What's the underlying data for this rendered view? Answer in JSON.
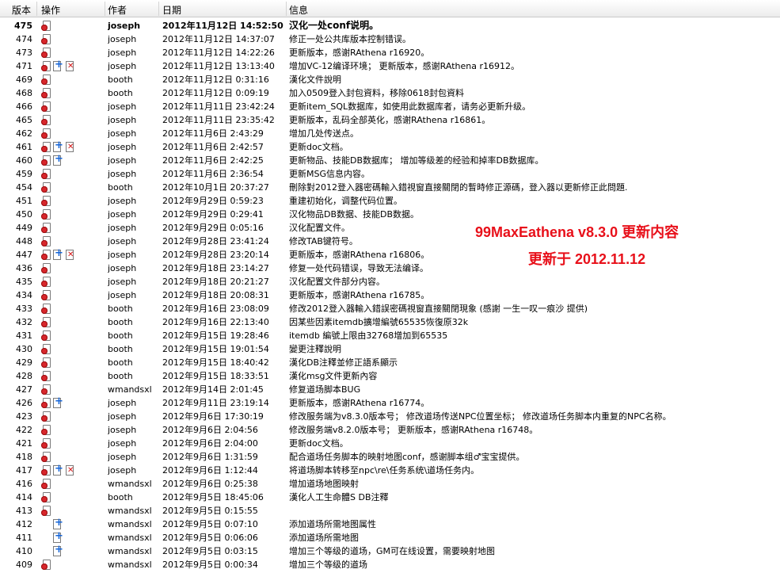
{
  "header": {
    "rev": "版本",
    "ops": "操作",
    "author": "作者",
    "date": "日期",
    "message": "信息"
  },
  "overlay": {
    "line1": "99MaxEathena v8.3.0 更新内容",
    "line2": "更新于 2012.11.12"
  },
  "rows": [
    {
      "rev": "475",
      "ops": [
        "file-doc-icon"
      ],
      "author": "joseph",
      "date": "2012年11月12日 14:52:50",
      "message": "汉化一处conf说明。"
    },
    {
      "rev": "474",
      "ops": [
        "file-doc-icon"
      ],
      "author": "joseph",
      "date": "2012年11月12日 14:37:07",
      "message": "修正一处公共库版本控制错误。"
    },
    {
      "rev": "473",
      "ops": [
        "file-doc-icon"
      ],
      "author": "joseph",
      "date": "2012年11月12日 14:22:26",
      "message": "更新版本，感谢RAthena r16920。"
    },
    {
      "rev": "471",
      "ops": [
        "file-doc-icon",
        "file-add-icon",
        "file-delete-icon"
      ],
      "author": "joseph",
      "date": "2012年11月12日 13:13:40",
      "message": "增加VC-12编译环境； 更新版本，感谢RAthena r16912。"
    },
    {
      "rev": "469",
      "ops": [
        "file-doc-icon"
      ],
      "author": "booth",
      "date": "2012年11月12日 0:31:16",
      "message": "漢化文件說明"
    },
    {
      "rev": "468",
      "ops": [
        "file-doc-icon"
      ],
      "author": "booth",
      "date": "2012年11月12日 0:09:19",
      "message": "加入0509登入封包資料，移除0618封包資料"
    },
    {
      "rev": "466",
      "ops": [
        "file-doc-icon"
      ],
      "author": "joseph",
      "date": "2012年11月11日 23:42:24",
      "message": "更新item_SQL数据库，如使用此数据库者，请务必更新升级。"
    },
    {
      "rev": "465",
      "ops": [
        "file-doc-icon"
      ],
      "author": "joseph",
      "date": "2012年11月11日 23:35:42",
      "message": "更新版本，乱码全部英化，感谢RAthena r16861。"
    },
    {
      "rev": "462",
      "ops": [
        "file-doc-icon"
      ],
      "author": "joseph",
      "date": "2012年11月6日 2:43:29",
      "message": "增加几处传送点。"
    },
    {
      "rev": "461",
      "ops": [
        "file-doc-icon",
        "file-add-icon",
        "file-delete-icon"
      ],
      "author": "joseph",
      "date": "2012年11月6日 2:42:57",
      "message": "更新doc文档。"
    },
    {
      "rev": "460",
      "ops": [
        "file-doc-icon",
        "file-add-icon"
      ],
      "author": "joseph",
      "date": "2012年11月6日 2:42:25",
      "message": "更新物品、技能DB数据库； 增加等级差的经验和掉率DB数据库。"
    },
    {
      "rev": "459",
      "ops": [
        "file-doc-icon"
      ],
      "author": "joseph",
      "date": "2012年11月6日 2:36:54",
      "message": "更新MSG信息内容。"
    },
    {
      "rev": "454",
      "ops": [
        "file-doc-icon"
      ],
      "author": "booth",
      "date": "2012年10月1日 20:37:27",
      "message": "刪除對2012登入器密碼輸入錯視窗直接關閉的暫時修正源碼，登入器以更新修正此問題."
    },
    {
      "rev": "451",
      "ops": [
        "file-doc-icon"
      ],
      "author": "joseph",
      "date": "2012年9月29日 0:59:23",
      "message": "重建初始化，调整代码位置。"
    },
    {
      "rev": "450",
      "ops": [
        "file-doc-icon"
      ],
      "author": "joseph",
      "date": "2012年9月29日 0:29:41",
      "message": "汉化物品DB数据、技能DB数据。"
    },
    {
      "rev": "449",
      "ops": [
        "file-doc-icon"
      ],
      "author": "joseph",
      "date": "2012年9月29日 0:05:16",
      "message": "汉化配置文件。"
    },
    {
      "rev": "448",
      "ops": [
        "file-doc-icon"
      ],
      "author": "joseph",
      "date": "2012年9月28日 23:41:24",
      "message": "修改TAB键符号。"
    },
    {
      "rev": "447",
      "ops": [
        "file-doc-icon",
        "file-add-icon",
        "file-delete-icon"
      ],
      "author": "joseph",
      "date": "2012年9月28日 23:20:14",
      "message": "更新版本，感谢RAthena r16806。"
    },
    {
      "rev": "436",
      "ops": [
        "file-doc-icon"
      ],
      "author": "joseph",
      "date": "2012年9月18日 23:14:27",
      "message": "修复一处代码错误，导致无法编译。"
    },
    {
      "rev": "435",
      "ops": [
        "file-doc-icon"
      ],
      "author": "joseph",
      "date": "2012年9月18日 20:21:27",
      "message": "汉化配置文件部分内容。"
    },
    {
      "rev": "434",
      "ops": [
        "file-doc-icon"
      ],
      "author": "joseph",
      "date": "2012年9月18日 20:08:31",
      "message": "更新版本，感谢RAthena r16785。"
    },
    {
      "rev": "433",
      "ops": [
        "file-doc-icon"
      ],
      "author": "booth",
      "date": "2012年9月16日 23:08:09",
      "message": "修改2012登入器輸入錯誤密碼視窗直接關閉現象 (感謝 一生一叹一痕沙 提供)"
    },
    {
      "rev": "432",
      "ops": [
        "file-doc-icon"
      ],
      "author": "booth",
      "date": "2012年9月16日 22:13:40",
      "message": "因某些因素itemdb擴增編號65535恢復原32k"
    },
    {
      "rev": "431",
      "ops": [
        "file-doc-icon"
      ],
      "author": "booth",
      "date": "2012年9月15日 19:28:46",
      "message": "itemdb 編號上限由32768增加到65535"
    },
    {
      "rev": "430",
      "ops": [
        "file-doc-icon"
      ],
      "author": "booth",
      "date": "2012年9月15日 19:01:54",
      "message": "變更注釋說明"
    },
    {
      "rev": "429",
      "ops": [
        "file-doc-icon"
      ],
      "author": "booth",
      "date": "2012年9月15日 18:40:42",
      "message": "漢化DB注釋並修正語系顯示"
    },
    {
      "rev": "428",
      "ops": [
        "file-doc-icon"
      ],
      "author": "booth",
      "date": "2012年9月15日 18:33:51",
      "message": "漢化msg文件更新內容"
    },
    {
      "rev": "427",
      "ops": [
        "file-doc-icon"
      ],
      "author": "wmandsxl",
      "date": "2012年9月14日 2:01:45",
      "message": "修复道场脚本BUG"
    },
    {
      "rev": "426",
      "ops": [
        "file-doc-icon",
        "file-add-icon"
      ],
      "author": "joseph",
      "date": "2012年9月11日 23:19:14",
      "message": "更新版本，感谢RAthena r16774。"
    },
    {
      "rev": "423",
      "ops": [
        "file-doc-icon"
      ],
      "author": "joseph",
      "date": "2012年9月6日 17:30:19",
      "message": "修改服务端为v8.3.0版本号； 修改道场传送NPC位置坐标； 修改道场任务脚本内重复的NPC名称。"
    },
    {
      "rev": "422",
      "ops": [
        "file-doc-icon"
      ],
      "author": "joseph",
      "date": "2012年9月6日 2:04:56",
      "message": "修改服务端v8.2.0版本号； 更新版本，感谢RAthena r16748。"
    },
    {
      "rev": "421",
      "ops": [
        "file-doc-icon"
      ],
      "author": "joseph",
      "date": "2012年9月6日 2:04:00",
      "message": "更新doc文档。"
    },
    {
      "rev": "418",
      "ops": [
        "file-doc-icon"
      ],
      "author": "joseph",
      "date": "2012年9月6日 1:31:59",
      "message": "配合道场任务脚本的映射地图conf，感谢脚本组♂宝宝提供。"
    },
    {
      "rev": "417",
      "ops": [
        "file-doc-icon",
        "file-add-icon",
        "file-delete-icon"
      ],
      "author": "joseph",
      "date": "2012年9月6日 1:12:44",
      "message": "将道场脚本转移至npc\\re\\任务系统\\道场任务内。"
    },
    {
      "rev": "416",
      "ops": [
        "file-doc-icon"
      ],
      "author": "wmandsxl",
      "date": "2012年9月6日 0:25:38",
      "message": "增加道场地图映射"
    },
    {
      "rev": "414",
      "ops": [
        "file-doc-icon"
      ],
      "author": "booth",
      "date": "2012年9月5日 18:45:06",
      "message": "漢化人工生命體S DB注釋"
    },
    {
      "rev": "413",
      "ops": [
        "file-doc-icon"
      ],
      "author": "wmandsxl",
      "date": "2012年9月5日 0:15:55",
      "message": ""
    },
    {
      "rev": "412",
      "ops": [
        "",
        "file-add-icon"
      ],
      "author": "wmandsxl",
      "date": "2012年9月5日 0:07:10",
      "message": "添加道场所需地图属性"
    },
    {
      "rev": "411",
      "ops": [
        "",
        "file-add-icon"
      ],
      "author": "wmandsxl",
      "date": "2012年9月5日 0:06:06",
      "message": "添加道场所需地图"
    },
    {
      "rev": "410",
      "ops": [
        "",
        "file-add-icon"
      ],
      "author": "wmandsxl",
      "date": "2012年9月5日 0:03:15",
      "message": "增加三个等级的道场，GM可在线设置，需要映射地图"
    },
    {
      "rev": "409",
      "ops": [
        "file-doc-icon"
      ],
      "author": "wmandsxl",
      "date": "2012年9月5日 0:00:34",
      "message": "增加三个等级的道场"
    }
  ]
}
